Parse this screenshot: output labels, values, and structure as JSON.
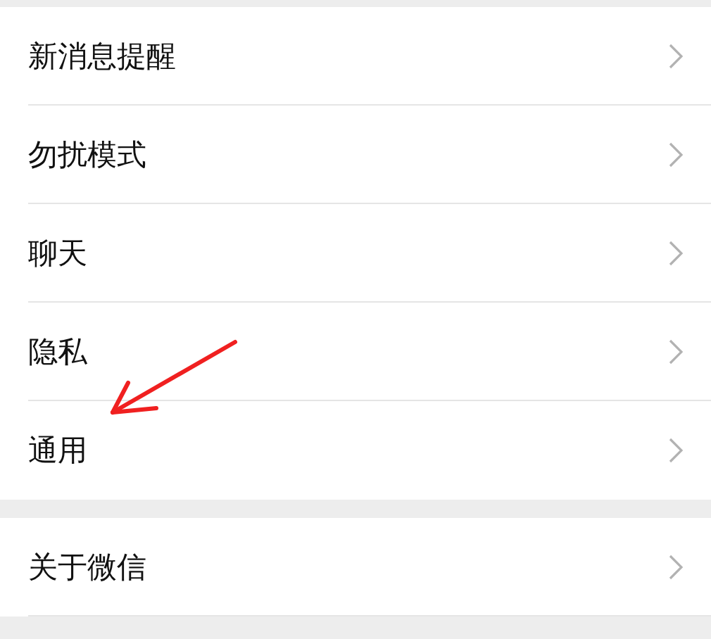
{
  "groups": [
    {
      "items": [
        {
          "label": "新消息提醒"
        },
        {
          "label": "勿扰模式"
        },
        {
          "label": "聊天"
        },
        {
          "label": "隐私"
        },
        {
          "label": "通用"
        }
      ]
    },
    {
      "items": [
        {
          "label": "关于微信"
        }
      ]
    }
  ]
}
